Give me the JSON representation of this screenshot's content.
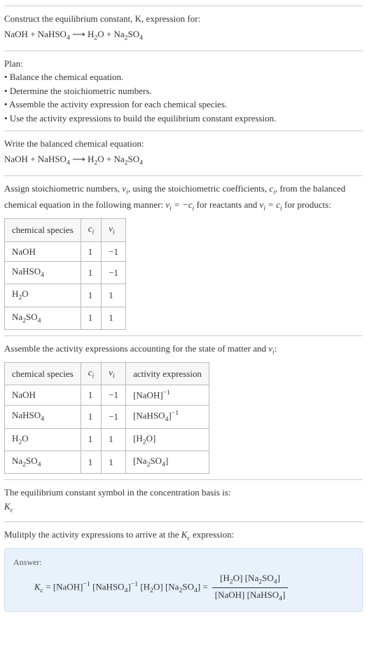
{
  "intro": {
    "line1": "Construct the equilibrium constant, K, expression for:"
  },
  "equation": {
    "lhs1": "NaOH",
    "plus": " + ",
    "lhs2": "NaHSO",
    "arrow": " ⟶ ",
    "rhs1": "H",
    "rhs1sub": "2",
    "rhs1b": "O",
    "rhs2": "Na",
    "rhs2sub": "2",
    "rhs2b": "SO",
    "rhs2sub2": "4",
    "lhs2sub": "4"
  },
  "plan": {
    "title": "Plan:",
    "items": [
      "Balance the chemical equation.",
      "Determine the stoichiometric numbers.",
      "Assemble the activity expression for each chemical species.",
      "Use the activity expressions to build the equilibrium constant expression."
    ]
  },
  "balanced": {
    "title": "Write the balanced chemical equation:"
  },
  "stoich": {
    "intro_a": "Assign stoichiometric numbers, ",
    "intro_b": ", using the stoichiometric coefficients, ",
    "intro_c": ", from the balanced chemical equation in the following manner: ",
    "intro_d": " for reactants and ",
    "intro_e": " for products:",
    "nu": "ν",
    "nu_i": "i",
    "c": "c",
    "c_i": "i",
    "eq1a": "ν",
    "eq1b": " = −c",
    "eq2a": "ν",
    "eq2b": " = c",
    "headers": {
      "h1": "chemical species",
      "h2": "c",
      "h2i": "i",
      "h3": "ν",
      "h3i": "i"
    },
    "rows": [
      {
        "sp": "NaOH",
        "c": "1",
        "nu": "−1"
      },
      {
        "sp": "NaHSO4",
        "c": "1",
        "nu": "−1"
      },
      {
        "sp": "H2O",
        "c": "1",
        "nu": "1"
      },
      {
        "sp": "Na2SO4",
        "c": "1",
        "nu": "1"
      }
    ]
  },
  "activity": {
    "title_a": "Assemble the activity expressions accounting for the state of matter and ",
    "title_b": ":",
    "headers": {
      "h1": "chemical species",
      "h2": "c",
      "h2i": "i",
      "h3": "ν",
      "h3i": "i",
      "h4": "activity expression"
    },
    "rows": [
      {
        "sp": "NaOH",
        "c": "1",
        "nu": "−1",
        "ae_pre": "[NaOH]",
        "ae_sup": "−1"
      },
      {
        "sp": "NaHSO4",
        "c": "1",
        "nu": "−1",
        "ae_pre": "[NaHSO4]",
        "ae_sup": "−1"
      },
      {
        "sp": "H2O",
        "c": "1",
        "nu": "1",
        "ae_pre": "[H2O]",
        "ae_sup": ""
      },
      {
        "sp": "Na2SO4",
        "c": "1",
        "nu": "1",
        "ae_pre": "[Na2SO4]",
        "ae_sup": ""
      }
    ]
  },
  "kc_symbol": {
    "line1": "The equilibrium constant symbol in the concentration basis is:",
    "sym": "K",
    "sub": "c"
  },
  "multiply": {
    "line1_a": "Mulitply the activity expressions to arrive at the ",
    "line1_b": " expression:"
  },
  "answer": {
    "label": "Answer:",
    "k": "K",
    "kc": "c",
    "eq": " = ",
    "t1": "[NaOH]",
    "t1s": "−1",
    "t2a": " [NaHSO",
    "t2sub": "4",
    "t2b": "]",
    "t2s": "−1",
    "t3a": " [H",
    "t3sub": "2",
    "t3b": "O] [Na",
    "t3sub2": "2",
    "t3c": "SO",
    "t3sub3": "4",
    "t3d": "] ",
    "eq2": "= ",
    "num_a": "[H",
    "num_b": "O] [Na",
    "num_c": "SO",
    "num_d": "]",
    "den_a": "[NaOH] [NaHSO",
    "den_b": "]"
  }
}
